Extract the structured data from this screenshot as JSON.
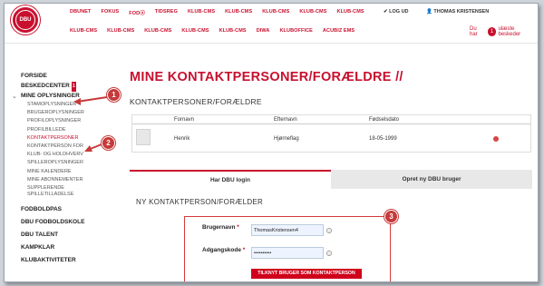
{
  "nav": {
    "row1": [
      "DBUNET",
      "FOKUS",
      "FODⓐ",
      "TIDSREG",
      "KLUB-CMS",
      "KLUB-CMS",
      "KLUB-CMS",
      "KLUB-CMS",
      "KLUB-CMS"
    ],
    "row2": [
      "KLUB-CMS",
      "KLUB-CMS",
      "KLUB-CMS",
      "KLUB-CMS",
      "KLUB-CMS",
      "DIWA",
      "KLUBOFFICE",
      "ACUBIZ EMS"
    ],
    "logout": "✔ LOG UD",
    "user": "👤 THOMAS KRISTENSEN",
    "msg_prefix": "Du har",
    "msg_count": "1",
    "msg_suffix": "ulæste beskeder"
  },
  "logo_text": "DBU",
  "sidebar": {
    "forside": "FORSIDE",
    "beskedcenter": "BESKEDCENTER",
    "beskedcenter_badge": "1",
    "mine_oplysninger": "MINE OPLYSNINGER",
    "sub": [
      "STAMOPLYSNINGER",
      "BRUGEROPLYSNINGER",
      "PROFILOPLYSNINGER",
      "PROFILBILLEDE",
      "KONTAKTPERSONER",
      "KONTAKTPERSON FOR",
      "KLUB- OG HOLDHVERV",
      "SPILLEROPLYSNINGER",
      "MINE KALENDERE",
      "MINE ABONNEMENTER",
      "SUPPLERENDE",
      "SPILLETILLADELSE"
    ],
    "bottom": [
      "FODBOLDPAS",
      "DBU FODBOLDSKOLE",
      "DBU TALENT",
      "KAMPKLAR",
      "KLUBAKTIVITETER"
    ]
  },
  "page_title": "MINE KONTAKTPERSONER/FORÆLDRE //",
  "section_title": "KONTAKTPERSONER/FORÆLDRE",
  "table": {
    "headers": [
      "Fornavn",
      "Efternavn",
      "Fødselsdato"
    ],
    "row": [
      "Henrik",
      "Hjørneflag",
      "18-05-1999"
    ]
  },
  "tabs": [
    "Har DBU login",
    "Opret ny DBU bruger"
  ],
  "new_title": "NY KONTAKTPERSON/FORÆLDER",
  "form": {
    "username_label": "Brugernavn",
    "username_value": "ThomasKristensen4",
    "password_label": "Adgangskode",
    "password_value": "••••••••••",
    "required_mark": "*",
    "submit": "TILKNYT BRUGER SOM KONTAKTPERSON"
  },
  "callouts": [
    "1",
    "2",
    "3"
  ],
  "colors": {
    "accent": "#c8102e",
    "callout": "#c63a3a"
  }
}
